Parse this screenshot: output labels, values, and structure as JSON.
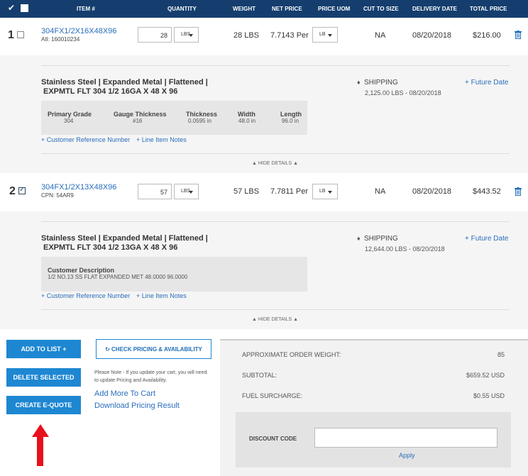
{
  "header": {
    "item": "ITEM #",
    "quantity": "QUANTITY",
    "weight": "WEIGHT",
    "net_price": "NET PRICE",
    "price_uom": "PRICE UOM",
    "cut_to_size": "CUT TO SIZE",
    "delivery_date": "DELIVERY DATE",
    "total_price": "TOTAL PRICE"
  },
  "items": [
    {
      "num": "1",
      "checked": false,
      "part": "304FX1/2X16X48X96",
      "sub": "AII: 160010234",
      "qty": "28",
      "qty_uom": "LBS",
      "weight": "28 LBS",
      "net_price": "7.7143 Per",
      "price_uom": "LB",
      "cut": "NA",
      "delivery": "08/20/2018",
      "total": "$216.00",
      "title_line1": "Stainless Steel | Expanded Metal | Flattened |",
      "title_line2": "EXPMTL FLT 304 1/2 16GA X 48 X 96",
      "shipping_label": "SHIPPING",
      "shipping_detail": "2,125.00 LBS - 08/20/2018",
      "future_date": "+ Future Date",
      "specs": [
        {
          "h": "Primary Grade",
          "v": "304"
        },
        {
          "h": "Gauge Thickness",
          "v": "#16"
        },
        {
          "h": "Thickness",
          "v": "0.0595 in"
        },
        {
          "h": "Width",
          "v": "48.0 in"
        },
        {
          "h": "Length",
          "v": "96.0 in"
        }
      ],
      "ref_link": "+ Customer Reference Number",
      "notes_link": "+ Line Item Notes",
      "hide": "HIDE DETAILS"
    },
    {
      "num": "2",
      "checked": true,
      "part": "304FX1/2X13X48X96",
      "sub": "CPN: 54AR9",
      "qty": "57",
      "qty_uom": "LBS",
      "weight": "57 LBS",
      "net_price": "7.7811 Per",
      "price_uom": "LB",
      "cut": "NA",
      "delivery": "08/20/2018",
      "total": "$443.52",
      "title_line1": "Stainless Steel | Expanded Metal | Flattened |",
      "title_line2": "EXPMTL FLT 304 1/2 13GA X 48 X 96",
      "shipping_label": "SHIPPING",
      "shipping_detail": "12,644.00 LBS - 08/20/2018",
      "future_date": "+ Future Date",
      "cust_desc_label": "Customer Description",
      "cust_desc": "1/2 NO.13 SS FLAT EXPANDED MET 48.0000 96.0000",
      "ref_link": "+ Customer Reference Number",
      "notes_link": "+ Line Item Notes",
      "hide": "HIDE DETAILS"
    }
  ],
  "actions": {
    "add_to_list": "ADD TO LIST +",
    "delete_selected": "DELETE SELECTED",
    "create_equote": "CREATE E-QUOTE",
    "check_pricing": "CHECK PRICING & AVAILABILITY",
    "note": "Please Note - If you update your cart, you will need to update Pricing and Availability.",
    "add_more": "Add More To Cart",
    "download": "Download Pricing Result"
  },
  "summary": {
    "approx_weight_label": "APPROXIMATE ORDER WEIGHT:",
    "approx_weight": "85",
    "subtotal_label": "SUBTOTAL:",
    "subtotal": "$659.52 USD",
    "fuel_label": "FUEL SURCHARGE:",
    "fuel": "$0.55 USD",
    "discount_label": "DISCOUNT CODE",
    "discount_value": "",
    "apply": "Apply"
  },
  "colors": {
    "header_bg": "#153e6e",
    "button_blue": "#1e87d2",
    "link_blue": "#2a6ebb",
    "annotation_arrow": "#e8101c"
  }
}
